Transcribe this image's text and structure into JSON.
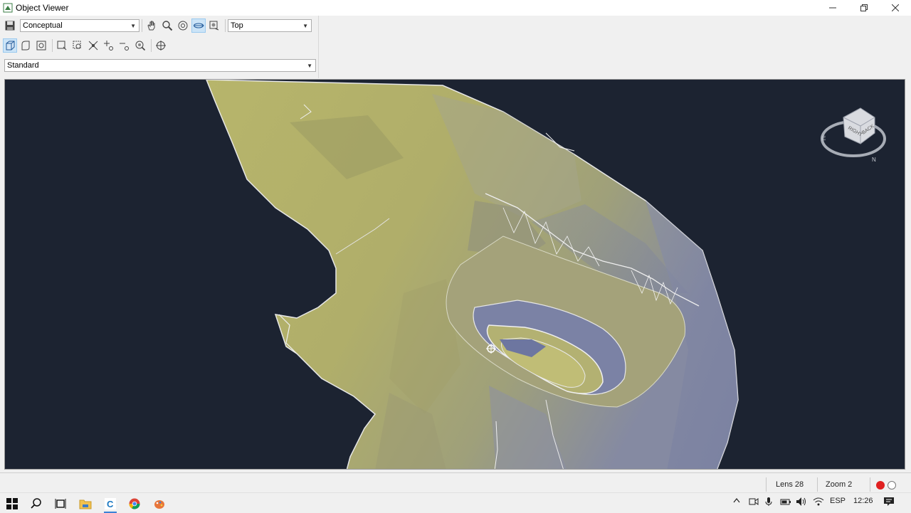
{
  "window": {
    "title": "Object Viewer",
    "controls": [
      "minimize",
      "restore",
      "close"
    ]
  },
  "toolbar": {
    "visual_style": "Conceptual",
    "view": "Top",
    "named_view": "Standard",
    "row1_icons": [
      "save-icon",
      "pan-icon",
      "zoom-icon",
      "orbit-icon",
      "free-orbit-icon",
      "continuous-orbit-icon"
    ],
    "row2_icons": [
      "perspective-icon",
      "parallel-icon",
      "camera-icon",
      "zoom-window-icon",
      "zoom-extents-icon",
      "zoom-realtime-icon",
      "zoom-in-icon",
      "zoom-out-icon",
      "zoom-object-icon",
      "ucs-icon"
    ]
  },
  "viewcube": {
    "faces": [
      "RIGHT",
      "BACK"
    ],
    "compass": [
      "E",
      "N"
    ]
  },
  "status": {
    "lens": "Lens 28",
    "zoom": "Zoom 2"
  },
  "taskbar": {
    "apps": [
      "start-icon",
      "search-icon",
      "task-view-icon",
      "file-explorer-icon",
      "civil3d-icon",
      "chrome-icon",
      "paint-icon"
    ],
    "language": "ESP",
    "time": "12:26"
  },
  "colors": {
    "viewport_bg": "#1c2331",
    "terrain_light": "#b5b36a",
    "terrain_shadow": "#7f86a0",
    "accent": "#3c82d6"
  }
}
